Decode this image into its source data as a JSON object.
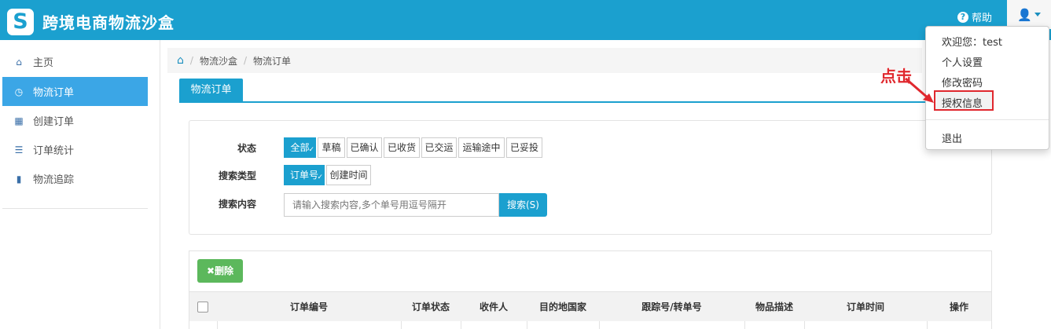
{
  "app": {
    "title": "跨境电商物流沙盒",
    "logo_letter": "S"
  },
  "header": {
    "help_label": "帮助",
    "help_icon": "question-icon",
    "user_icon": "user-icon"
  },
  "sidebar": {
    "items": [
      {
        "label": "主页",
        "icon": "home-icon",
        "active": false
      },
      {
        "label": "物流订单",
        "icon": "clock-icon",
        "active": true
      },
      {
        "label": "创建订单",
        "icon": "grid-icon",
        "active": false
      },
      {
        "label": "订单统计",
        "icon": "list-icon",
        "active": false
      },
      {
        "label": "物流追踪",
        "icon": "bar-chart-icon",
        "active": false
      }
    ]
  },
  "breadcrumb": {
    "items": [
      "物流沙盒",
      "物流订单"
    ]
  },
  "tabs": [
    {
      "label": "物流订单",
      "active": true
    }
  ],
  "filters": {
    "status": {
      "label": "状态",
      "options": [
        "全部",
        "草稿",
        "已确认",
        "已收货",
        "已交运",
        "运输途中",
        "已妥投"
      ],
      "selected": "全部"
    },
    "search_type": {
      "label": "搜索类型",
      "options": [
        "订单号",
        "创建时间"
      ],
      "selected": "订单号"
    },
    "search_content": {
      "label": "搜索内容",
      "placeholder": "请输入搜索内容,多个单号用逗号隔开",
      "button_label": "搜索(S)"
    }
  },
  "table": {
    "delete_label": "✖删除",
    "columns": [
      "订单编号",
      "订单状态",
      "收件人",
      "目的地国家",
      "跟踪号/转单号",
      "物品描述",
      "订单时间",
      "操作"
    ]
  },
  "user_menu": {
    "items": [
      "欢迎您：test",
      "个人设置",
      "修改密码",
      "授权信息",
      "退出"
    ],
    "highlighted": "授权信息"
  },
  "annotation": {
    "text": "点击",
    "color": "#e0282e"
  },
  "colors": {
    "primary": "#1ba0cf",
    "sidebar_active": "#3ba6e6",
    "delete": "#5cb85c"
  }
}
